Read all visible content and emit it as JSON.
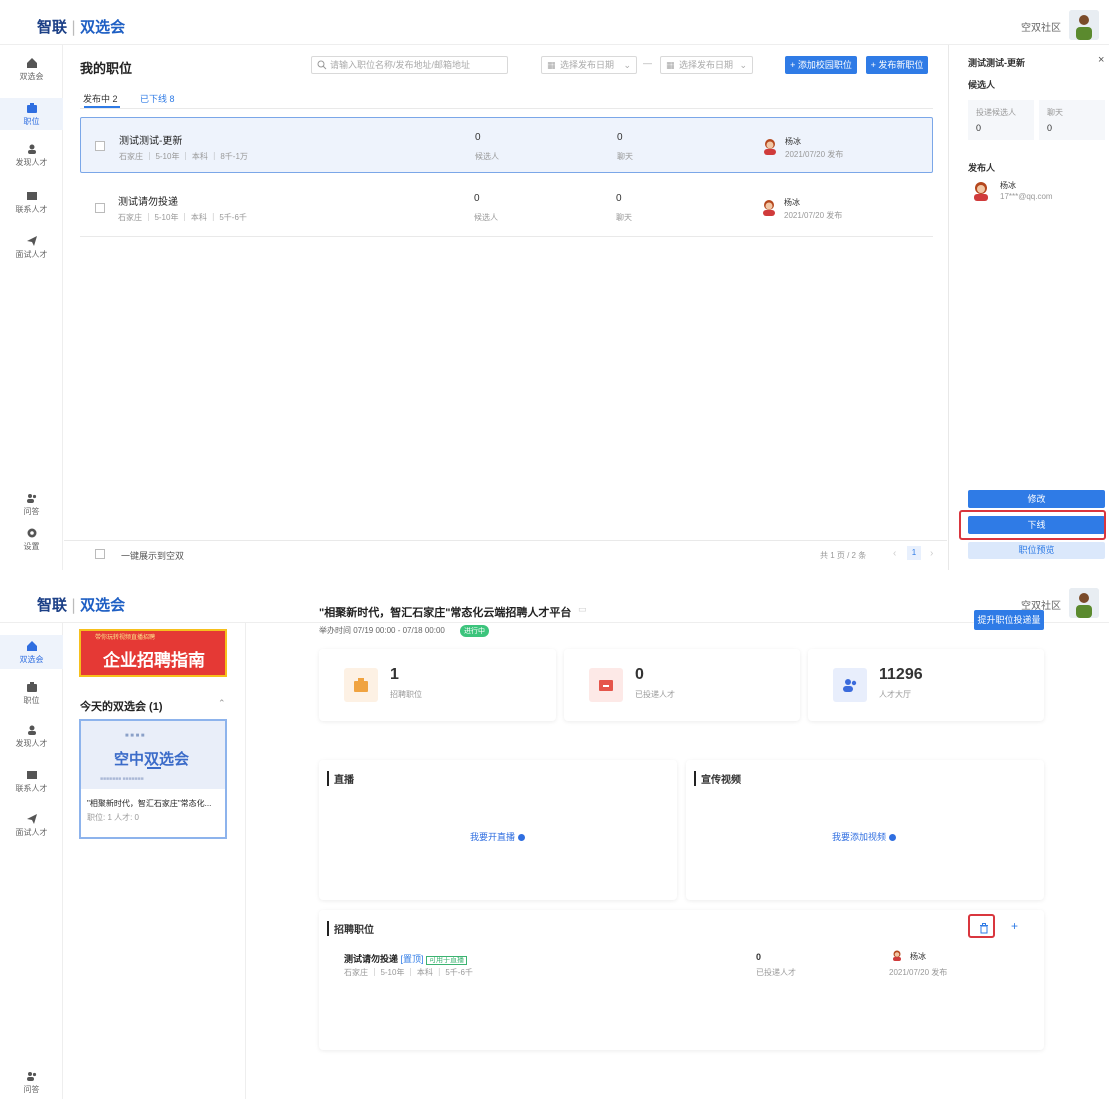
{
  "app": {
    "logo_a": "智联",
    "logo_sep": "|",
    "logo_b": "双选会",
    "community": "空双社区"
  },
  "sidebar": {
    "top": [
      "双选会",
      "职位",
      "发现人才",
      "联系人才",
      "面试人才"
    ],
    "bottom": [
      "问答",
      "设置"
    ]
  },
  "jobs": {
    "title": "我的职位",
    "search_placeholder": "请输入职位名称/发布地址/邮箱地址",
    "date_start": "选择发布日期",
    "date_sep": "—",
    "date_end": "选择发布日期",
    "add_campus": "+ 添加校园职位",
    "publish_new": "+ 发布新职位",
    "tabs": [
      "发布中 2",
      "已下线 8"
    ],
    "rows": [
      {
        "name": "测试测试-更新",
        "meta": "石家庄 ｜ 5-10年 ｜ 本科 ｜ 8千-1万",
        "cand": "0",
        "cand_label": "候选人",
        "chat": "0",
        "chat_label": "聊天",
        "publisher": "杨冰",
        "date": "2021/07/20 发布"
      },
      {
        "name": "测试请勿投递",
        "meta": "石家庄 ｜ 5-10年 ｜ 本科 ｜ 5千-6千",
        "cand": "0",
        "cand_label": "候选人",
        "chat": "0",
        "chat_label": "聊天",
        "publisher": "杨冰",
        "date": "2021/07/20 发布"
      }
    ],
    "footer_check": "一键展示到空双",
    "pager_text": "共 1 页 / 2 条",
    "pager_prev": "‹",
    "pager_page": "1",
    "pager_next": "›"
  },
  "detail": {
    "title": "测试测试-更新",
    "close": "×",
    "cand_head": "候选人",
    "stat1_label": "投递候选人",
    "stat1_val": "0",
    "stat2_label": "聊天",
    "stat2_val": "0",
    "publisher_head": "发布人",
    "publisher_name": "杨冰",
    "publisher_email": "17***@qq.com",
    "btn_edit": "修改",
    "btn_offline": "下线",
    "btn_preview": "职位预览"
  },
  "fair": {
    "banner_small": "带你玩转视频直播招聘",
    "banner_main": "企业招聘指南",
    "today_title": "今天的双选会 (1)",
    "card_sub": "■ ■ ■ ■",
    "card_main": "空中双选会",
    "card_dots": "■■■■■■■ ■■■■■■■",
    "card_name": "\"相聚新时代，智汇石家庄\"常态化...",
    "card_meta": "职位: 1    人才: 0",
    "event_title": "\"相聚新时代，智汇石家庄\"常态化云端招聘人才平台",
    "event_time": "举办时间 07/19 00:00 - 07/18 00:00",
    "event_badge": "进行中",
    "boost": "提升职位投递量",
    "stats": [
      {
        "num": "1",
        "label": "招聘职位"
      },
      {
        "num": "0",
        "label": "已投递人才"
      },
      {
        "num": "11296",
        "label": "人才大厅"
      }
    ],
    "live_title": "直播",
    "live_link": "我要开直播",
    "video_title": "宣传视频",
    "video_link": "我要添加视频",
    "jobs_title": "招聘职位",
    "add": "+",
    "job_name": "测试请勿投递",
    "tag1": "[置顶]",
    "tag2": "可用于直播",
    "job_meta": "石家庄 ｜ 5-10年 ｜ 本科 ｜ 5千-6千",
    "job_count": "0",
    "job_count_label": "已投递人才",
    "job_pub": "杨冰",
    "job_date": "2021/07/20 发布"
  }
}
